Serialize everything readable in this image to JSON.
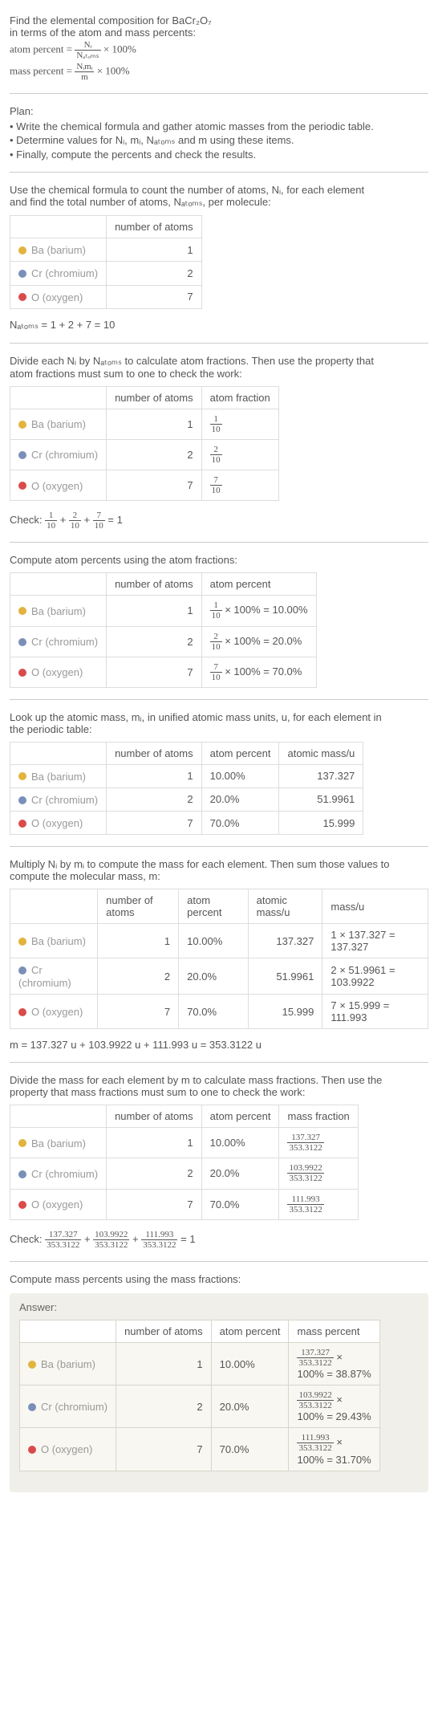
{
  "intro": {
    "line1": "Find the elemental composition for BaCr₂O₇",
    "line2": " in terms of the atom and mass percents:",
    "atom_percent_label": "atom percent = ",
    "atom_percent_frac_num": "Nᵢ",
    "atom_percent_frac_den": "Nₐₜₒₘₛ",
    "times100": " × 100%",
    "mass_percent_label": "mass percent = ",
    "mass_percent_frac_num": "Nᵢmᵢ",
    "mass_percent_frac_den": "m"
  },
  "plan": {
    "title": "Plan:",
    "items": [
      "• Write the chemical formula and gather atomic masses from the periodic table.",
      "• Determine values for Nᵢ, mᵢ, Nₐₜₒₘₛ and m using these items.",
      "• Finally, compute the percents and check the results."
    ]
  },
  "step1": {
    "text1": "Use the chemical formula to count the number of atoms, Nᵢ, for each element",
    "text2": "and find the total number of atoms, Nₐₜₒₘₛ, per molecule:",
    "col_count": "number of atoms",
    "rows": [
      {
        "color": "#e2b33d",
        "name": "Ba (barium)",
        "n": "1"
      },
      {
        "color": "#7a8fb8",
        "name": "Cr (chromium)",
        "n": "2"
      },
      {
        "color": "#d94b4b",
        "name": "O (oxygen)",
        "n": "7"
      }
    ],
    "sum": "Nₐₜₒₘₛ = 1 + 2 + 7 = 10"
  },
  "step2": {
    "text1": "Divide each Nᵢ by Nₐₜₒₘₛ to calculate atom fractions. Then use the property that",
    "text2": "atom fractions must sum to one to check the work:",
    "col_count": "number of atoms",
    "col_frac": "atom fraction",
    "rows": [
      {
        "color": "#e2b33d",
        "name": "Ba (barium)",
        "n": "1",
        "fn": "1",
        "fd": "10"
      },
      {
        "color": "#7a8fb8",
        "name": "Cr (chromium)",
        "n": "2",
        "fn": "2",
        "fd": "10"
      },
      {
        "color": "#d94b4b",
        "name": "O (oxygen)",
        "n": "7",
        "fn": "7",
        "fd": "10"
      }
    ],
    "check": "Check: ",
    "check_eq": " = 1"
  },
  "step3": {
    "text": "Compute atom percents using the atom fractions:",
    "col_count": "number of atoms",
    "col_pct": "atom percent",
    "rows": [
      {
        "color": "#e2b33d",
        "name": "Ba (barium)",
        "n": "1",
        "fn": "1",
        "fd": "10",
        "res": " × 100% = 10.00%"
      },
      {
        "color": "#7a8fb8",
        "name": "Cr (chromium)",
        "n": "2",
        "fn": "2",
        "fd": "10",
        "res": " × 100% = 20.0%"
      },
      {
        "color": "#d94b4b",
        "name": "O (oxygen)",
        "n": "7",
        "fn": "7",
        "fd": "10",
        "res": " × 100% = 70.0%"
      }
    ]
  },
  "step4": {
    "text1": "Look up the atomic mass, mᵢ, in unified atomic mass units, u, for each element in",
    "text2": "the periodic table:",
    "col_count": "number of atoms",
    "col_pct": "atom percent",
    "col_mass": "atomic mass/u",
    "rows": [
      {
        "color": "#e2b33d",
        "name": "Ba (barium)",
        "n": "1",
        "pct": "10.00%",
        "mass": "137.327"
      },
      {
        "color": "#7a8fb8",
        "name": "Cr (chromium)",
        "n": "2",
        "pct": "20.0%",
        "mass": "51.9961"
      },
      {
        "color": "#d94b4b",
        "name": "O (oxygen)",
        "n": "7",
        "pct": "70.0%",
        "mass": "15.999"
      }
    ]
  },
  "step5": {
    "text1": "Multiply Nᵢ by mᵢ to compute the mass for each element. Then sum those values to",
    "text2": "compute the molecular mass, m:",
    "col_count": "number of atoms",
    "col_pct": "atom percent",
    "col_mass": "atomic mass/u",
    "col_massu": "mass/u",
    "rows": [
      {
        "color": "#e2b33d",
        "name": "Ba (barium)",
        "n": "1",
        "pct": "10.00%",
        "mass": "137.327",
        "calc": "1 × 137.327 = 137.327"
      },
      {
        "color": "#7a8fb8",
        "name": "Cr (chromium)",
        "n": "2",
        "pct": "20.0%",
        "mass": "51.9961",
        "calc": "2 × 51.9961 = 103.9922"
      },
      {
        "color": "#d94b4b",
        "name": "O (oxygen)",
        "n": "7",
        "pct": "70.0%",
        "mass": "15.999",
        "calc": "7 × 15.999 = 111.993"
      }
    ],
    "sum": "m = 137.327 u + 103.9922 u + 111.993 u = 353.3122 u"
  },
  "step6": {
    "text1": "Divide the mass for each element by m to calculate mass fractions. Then use the",
    "text2": "property that mass fractions must sum to one to check the work:",
    "col_count": "number of atoms",
    "col_pct": "atom percent",
    "col_mf": "mass fraction",
    "rows": [
      {
        "color": "#e2b33d",
        "name": "Ba (barium)",
        "n": "1",
        "pct": "10.00%",
        "fn": "137.327",
        "fd": "353.3122"
      },
      {
        "color": "#7a8fb8",
        "name": "Cr (chromium)",
        "n": "2",
        "pct": "20.0%",
        "fn": "103.9922",
        "fd": "353.3122"
      },
      {
        "color": "#d94b4b",
        "name": "O (oxygen)",
        "n": "7",
        "pct": "70.0%",
        "fn": "111.993",
        "fd": "353.3122"
      }
    ],
    "check": "Check: ",
    "check_eq": " = 1"
  },
  "step7": {
    "text": "Compute mass percents using the mass fractions:"
  },
  "answer": {
    "label": "Answer:",
    "col_count": "number of atoms",
    "col_pct": "atom percent",
    "col_mp": "mass percent",
    "rows": [
      {
        "color": "#e2b33d",
        "name": "Ba (barium)",
        "n": "1",
        "pct": "10.00%",
        "fn": "137.327",
        "fd": "353.3122",
        "res": "100% = 38.87%"
      },
      {
        "color": "#7a8fb8",
        "name": "Cr (chromium)",
        "n": "2",
        "pct": "20.0%",
        "fn": "103.9922",
        "fd": "353.3122",
        "res": "100% = 29.43%"
      },
      {
        "color": "#d94b4b",
        "name": "O (oxygen)",
        "n": "7",
        "pct": "70.0%",
        "fn": "111.993",
        "fd": "353.3122",
        "res": "100% = 31.70%"
      }
    ],
    "times": " ×"
  }
}
